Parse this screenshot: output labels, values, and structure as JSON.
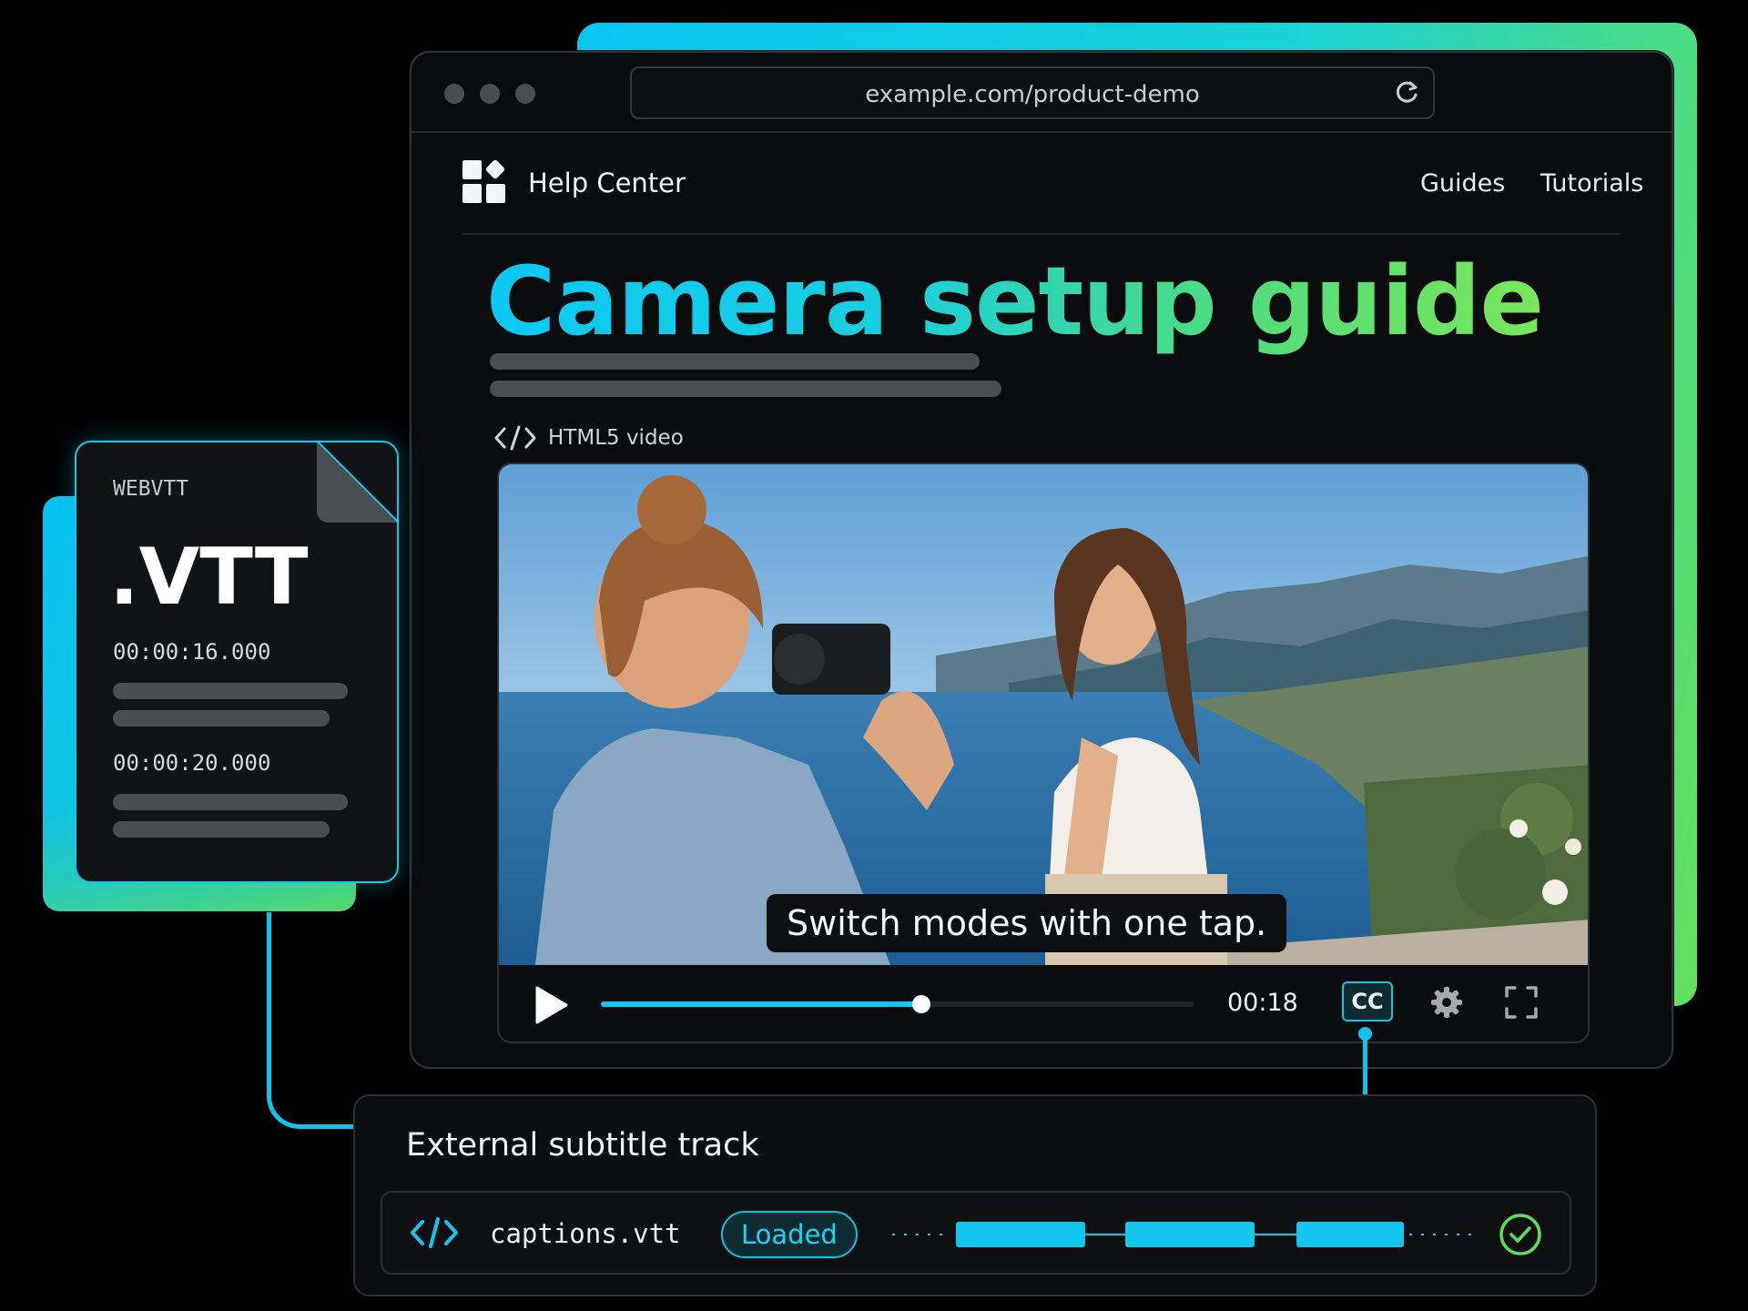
{
  "browser": {
    "url": "example.com/product-demo"
  },
  "site": {
    "name": "Help Center",
    "nav": [
      {
        "label": "Guides"
      },
      {
        "label": "Tutorials"
      }
    ]
  },
  "page": {
    "title": "Camera setup guide",
    "video_label": "HTML5 video"
  },
  "video": {
    "caption": "Switch modes with one tap.",
    "current_time": "00:18",
    "progress": 0.54,
    "cc_label": "CC"
  },
  "vtt_file": {
    "kind": "WEBVTT",
    "extension": ".VTT",
    "cues": [
      {
        "time": "00:00:16.000"
      },
      {
        "time": "00:00:20.000"
      }
    ]
  },
  "subtitle_panel": {
    "title": "External subtitle track",
    "file_name": "captions.vtt",
    "status": "Loaded"
  },
  "icons": [
    "reload-icon",
    "logo-icon",
    "code-icon",
    "play-icon",
    "gear-icon",
    "fullscreen-icon",
    "check-icon"
  ],
  "colors": {
    "accent_cyan": "#10c6f0",
    "accent_green": "#63e05c",
    "background": "#000000"
  }
}
